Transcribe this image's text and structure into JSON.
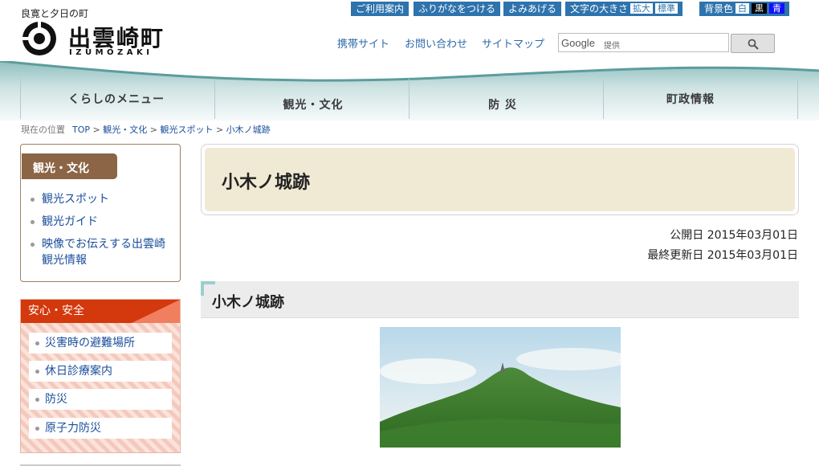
{
  "header": {
    "slogan": "良寛と夕日の町",
    "town_name": "出雲崎町",
    "town_roman": "IZUMOZAKI",
    "utility": {
      "guide": "ご利用案内",
      "furigana": "ふりがなをつける",
      "readaloud": "よみあげる",
      "text_size_label": "文字の大きさ",
      "text_size_large": "拡大",
      "text_size_normal": "標準",
      "bg_label": "背景色",
      "bg_white": "白",
      "bg_black": "黒",
      "bg_blue": "青"
    },
    "links": {
      "mobile": "携帯サイト",
      "contact": "お問い合わせ",
      "sitemap": "サイトマップ"
    },
    "search": {
      "brand": "Google",
      "placeholder": "提供"
    }
  },
  "nav": {
    "items": [
      "くらしのメニュー",
      "観光・文化",
      "防 災",
      "町政情報"
    ]
  },
  "breadcrumb": {
    "label": "現在の位置",
    "items": [
      "TOP",
      "観光・文化",
      "観光スポット",
      "小木ノ城跡"
    ],
    "sep": ">"
  },
  "sidebar": {
    "category": "観光・文化",
    "links": [
      "観光スポット",
      "観光ガイド",
      "映像でお伝えする出雲崎観光情報"
    ],
    "safety": {
      "title": "安心・安全",
      "links": [
        "災害時の避難場所",
        "休日診療案内",
        "防災",
        "原子力防災"
      ]
    }
  },
  "main": {
    "title": "小木ノ城跡",
    "published": "公開日 2015年03月01日",
    "updated": "最終更新日 2015年03月01日",
    "section_title": "小木ノ城跡"
  },
  "colors": {
    "util_bg": "#2e73ad",
    "category_tab": "#8b6545",
    "safety_head": "#d4380d",
    "title_bg": "#f0e9d4"
  }
}
